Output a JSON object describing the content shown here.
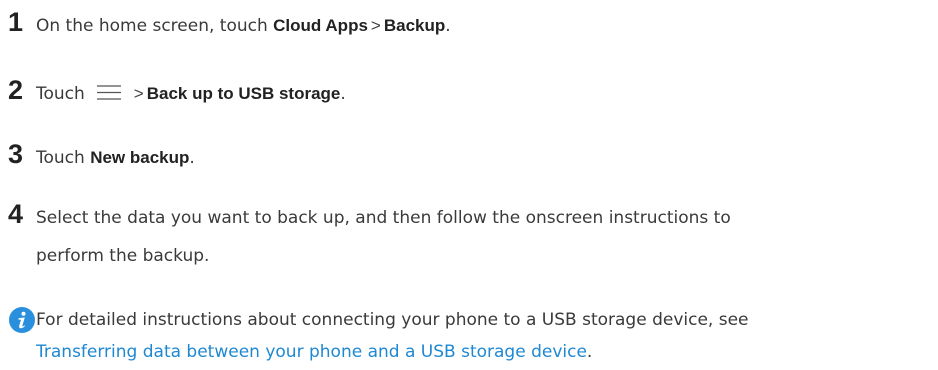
{
  "steps": [
    {
      "number": "1",
      "text_before": "On the home screen, touch ",
      "bold_1": "Cloud Apps",
      "separator": ">",
      "bold_2": "Backup",
      "text_after": "."
    },
    {
      "number": "2",
      "text_before": "Touch",
      "icon": "menu-icon",
      "separator": ">",
      "bold_1": "Back up to USB storage",
      "text_after": "."
    },
    {
      "number": "3",
      "text_before": "Touch ",
      "bold_1": "New backup",
      "text_after": "."
    },
    {
      "number": "4",
      "line_1": "Select the data you want to back up, and then follow the onscreen instructions to",
      "line_2": "perform the backup."
    }
  ],
  "note": {
    "icon": "info-icon",
    "text": "For detailed instructions about connecting your phone to a USB storage device, see",
    "link": "Transferring data between your phone and a USB storage device",
    "link_after": "."
  },
  "colors": {
    "accent": "#1e88d2",
    "text": "#3a3a3a",
    "heading": "#222222"
  }
}
